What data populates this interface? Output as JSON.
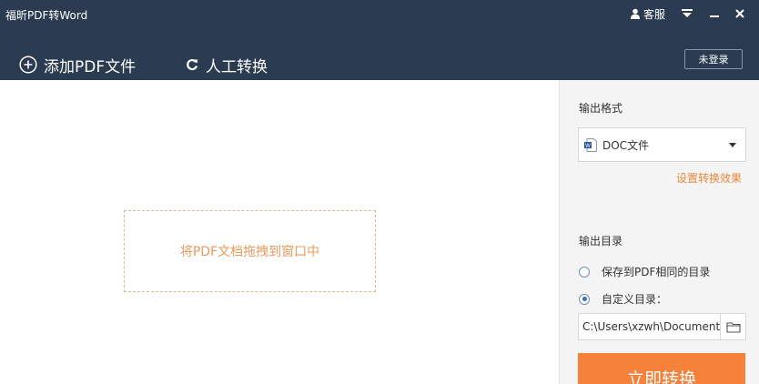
{
  "app": {
    "title": "福昕PDF转Word"
  },
  "window_controls": {
    "service_label": "客服"
  },
  "toolbar": {
    "add_pdf_label": "添加PDF文件",
    "manual_convert_label": "人工转换",
    "login_label": "未登录"
  },
  "dropzone": {
    "hint": "将PDF文档拖拽到窗口中"
  },
  "sidebar": {
    "output_format_label": "输出格式",
    "format_selected": "DOC文件",
    "format_icon_letter": "W",
    "settings_link": "设置转换效果",
    "output_dir_label": "输出目录",
    "option_same_dir": "保存到PDF相同的目录",
    "option_custom_dir": "自定义目录：",
    "selected_option": "custom",
    "path_value": "C:\\Users\\xzwh\\Documents",
    "convert_label": "立即转换"
  },
  "colors": {
    "titlebar_bg": "#2b3b52",
    "accent_orange": "#f6813b",
    "link_orange": "#ea8a3c",
    "dropzone_border": "#e3b88f",
    "sidebar_bg": "#f4f4f4"
  },
  "icons": {
    "service": "user-icon",
    "menu": "dropdown-triangle-icon",
    "minimize": "minimize-icon",
    "close": "close-icon",
    "add": "plus-circle-icon",
    "manual": "refresh-icon",
    "doc": "word-doc-icon",
    "browse": "folder-icon"
  }
}
